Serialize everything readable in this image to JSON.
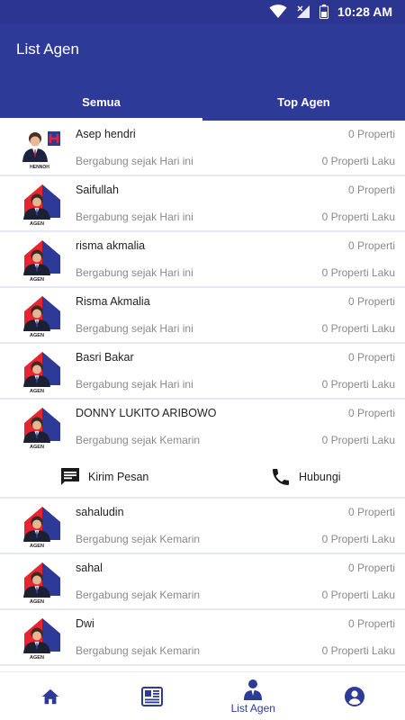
{
  "status_bar": {
    "time": "10:28 AM"
  },
  "app_bar": {
    "title": "List Agen"
  },
  "tabs": [
    {
      "label": "Semua",
      "active": true
    },
    {
      "label": "Top Agen",
      "active": false
    }
  ],
  "agents": [
    {
      "name": "Asep hendri",
      "properties": "0 Properti",
      "joined": "Bergabung sejak Hari ini",
      "sold": "0 Properti Laku",
      "avatar": "hennoh"
    },
    {
      "name": "Saifullah",
      "properties": "0 Properti",
      "joined": "Bergabung sejak Hari ini",
      "sold": "0 Properti Laku",
      "avatar": "agen"
    },
    {
      "name": "risma akmalia",
      "properties": "0 Properti",
      "joined": "Bergabung sejak Hari ini",
      "sold": "0 Properti Laku",
      "avatar": "agen"
    },
    {
      "name": "Risma Akmalia",
      "properties": "0 Properti",
      "joined": "Bergabung sejak Hari ini",
      "sold": "0 Properti Laku",
      "avatar": "agen"
    },
    {
      "name": "Basri Bakar",
      "properties": "0 Properti",
      "joined": "Bergabung sejak Hari ini",
      "sold": "0 Properti Laku",
      "avatar": "agen"
    },
    {
      "name": "DONNY LUKITO ARIBOWO",
      "properties": "0 Properti",
      "joined": "Bergabung sejak Kemarin",
      "sold": "0 Properti Laku",
      "avatar": "agen"
    },
    {
      "name": "sahaludin",
      "properties": "0 Properti",
      "joined": "Bergabung sejak Kemarin",
      "sold": "0 Properti Laku",
      "avatar": "agen"
    },
    {
      "name": "sahal",
      "properties": "0 Properti",
      "joined": "Bergabung sejak Kemarin",
      "sold": "0 Properti Laku",
      "avatar": "agen"
    },
    {
      "name": "Dwi",
      "properties": "0 Properti",
      "joined": "Bergabung sejak Kemarin",
      "sold": "0 Properti Laku",
      "avatar": "agen"
    }
  ],
  "avatar_labels": {
    "agen": "AGEN",
    "hennoh": "HENNOH"
  },
  "expanded_actions": {
    "message": "Kirim Pesan",
    "call": "Hubungi"
  },
  "bottom_nav": [
    {
      "label": "",
      "icon": "home-icon"
    },
    {
      "label": "",
      "icon": "newspaper-icon"
    },
    {
      "label": "List Agen",
      "icon": "agent-icon",
      "active": true
    },
    {
      "label": "",
      "icon": "account-icon"
    }
  ],
  "colors": {
    "primary": "#2e3a98",
    "house_red": "#e8242e",
    "divider": "#e6e8f4"
  }
}
